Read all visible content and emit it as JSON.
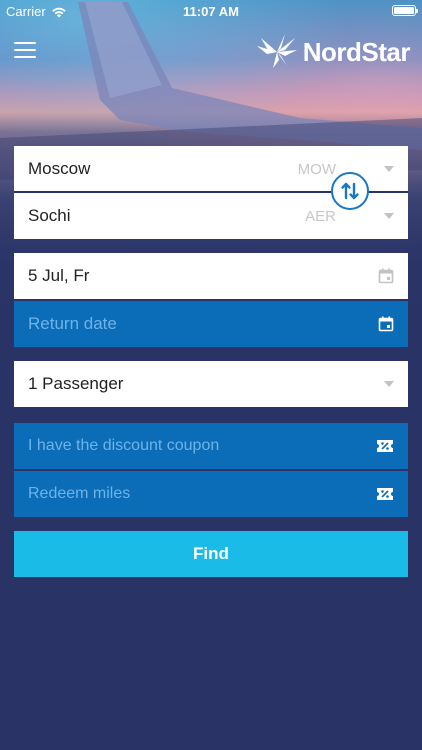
{
  "status_bar": {
    "carrier": "Carrier",
    "time": "11:07 AM"
  },
  "header": {
    "logo_text": "NordStar"
  },
  "form": {
    "origin": {
      "city": "Moscow",
      "code": "MOW"
    },
    "destination": {
      "city": "Sochi",
      "code": "AER"
    },
    "departure_date": "5 Jul, Fr",
    "return_date_placeholder": "Return date",
    "passengers": "1 Passenger",
    "coupon_label": "I have the discount coupon",
    "miles_label": "Redeem miles",
    "find_label": "Find"
  },
  "colors": {
    "background": "#2a3366",
    "field_blue": "#0b6db8",
    "find_button": "#1bbbe8",
    "accent": "#1a78c2"
  },
  "icons": {
    "menu": "hamburger-menu-icon",
    "logo": "bird-logo-icon",
    "swap": "swap-arrows-icon",
    "dropdown": "chevron-down-icon",
    "calendar": "calendar-icon",
    "ticket": "ticket-discount-icon"
  }
}
